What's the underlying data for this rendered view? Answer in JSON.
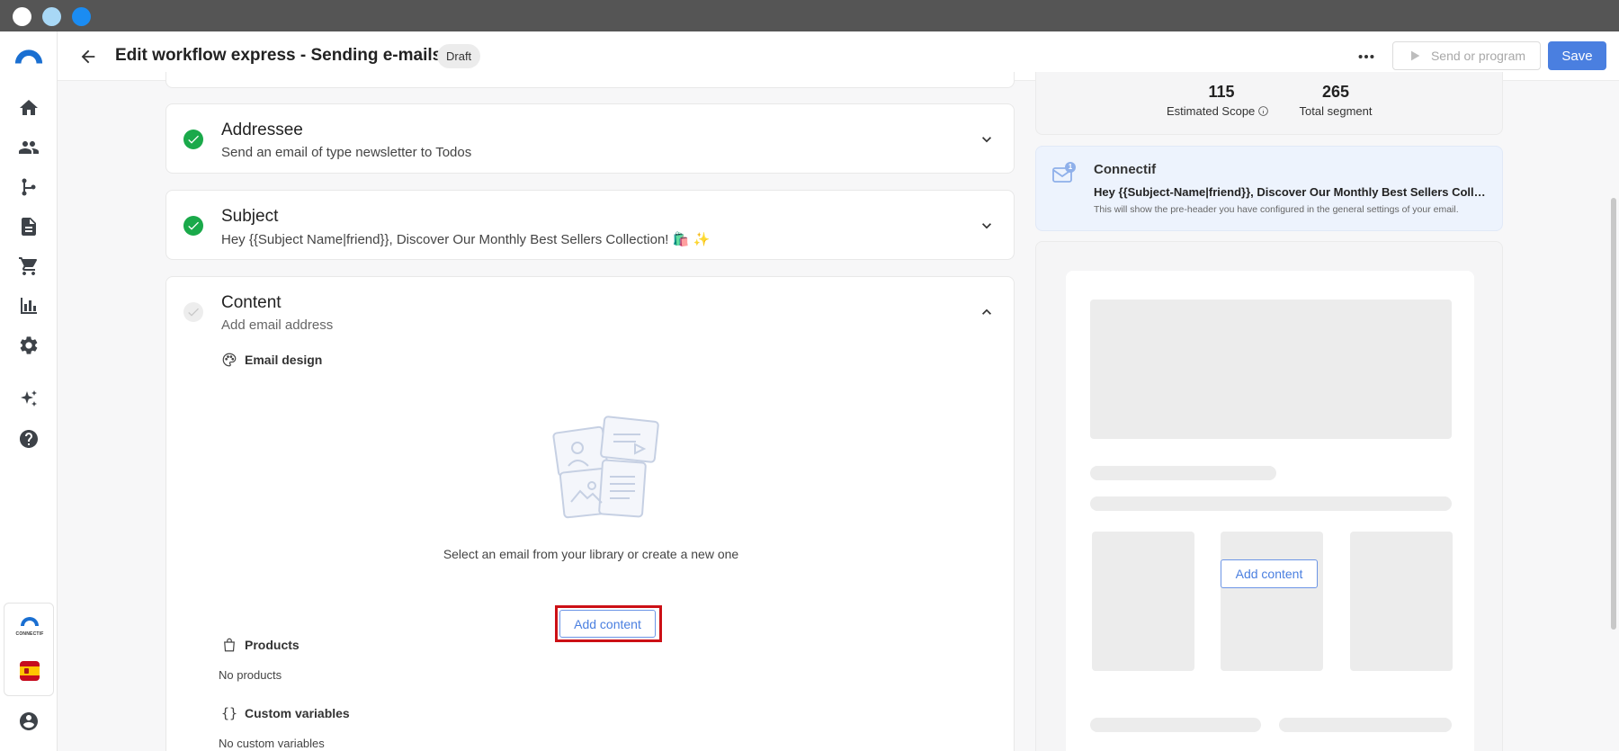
{
  "os": {
    "dot_colors": [
      "#ffffff",
      "#a8d8f6",
      "#1b8cf2"
    ]
  },
  "nav": {
    "items": [
      {
        "name": "home-icon"
      },
      {
        "name": "contacts-icon"
      },
      {
        "name": "workflows-icon"
      },
      {
        "name": "content-icon"
      },
      {
        "name": "cart-icon"
      },
      {
        "name": "analytics-icon"
      },
      {
        "name": "settings-icon"
      },
      {
        "name": "ai-sparkle-icon"
      },
      {
        "name": "help-icon"
      }
    ],
    "brand_label": "CONNECTIF",
    "account_icon": "account-icon"
  },
  "header": {
    "title": "Edit workflow express - Sending e-mails",
    "status_badge": "Draft",
    "more_icon": "more-horizontal-icon",
    "send_label": "Send or program",
    "save_label": "Save"
  },
  "steps": {
    "addressee": {
      "title": "Addressee",
      "subtitle": "Send an email of type newsletter to Todos",
      "status": "complete"
    },
    "subject": {
      "title": "Subject",
      "subtitle": "Hey {{Subject Name|friend}}, Discover Our Monthly Best Sellers Collection! 🛍️ ✨",
      "status": "complete"
    },
    "content": {
      "title": "Content",
      "subtitle": "Add email address",
      "status": "pending",
      "email_design_label": "Email design",
      "empty_message": "Select an email from your library or create a new one",
      "add_content_label": "Add content",
      "products_label": "Products",
      "products_empty": "No products",
      "custom_vars_label": "Custom variables",
      "custom_vars_empty": "No custom variables"
    }
  },
  "preview": {
    "estimated_scope": {
      "value": "115",
      "label": "Estimated Scope"
    },
    "total_segment": {
      "value": "265",
      "label": "Total segment"
    },
    "sender": {
      "name": "Connectif",
      "badge_count": "1",
      "subject": "Hey {{Subject-Name|friend}}, Discover Our Monthly Best Sellers Collecti…",
      "preheader_note": "This will show the pre-header you have configured in the general settings of your email."
    },
    "add_content_label": "Add content"
  },
  "colors": {
    "accent": "#4a7fe0",
    "success": "#1aa94a",
    "highlight": "#cc1016"
  }
}
